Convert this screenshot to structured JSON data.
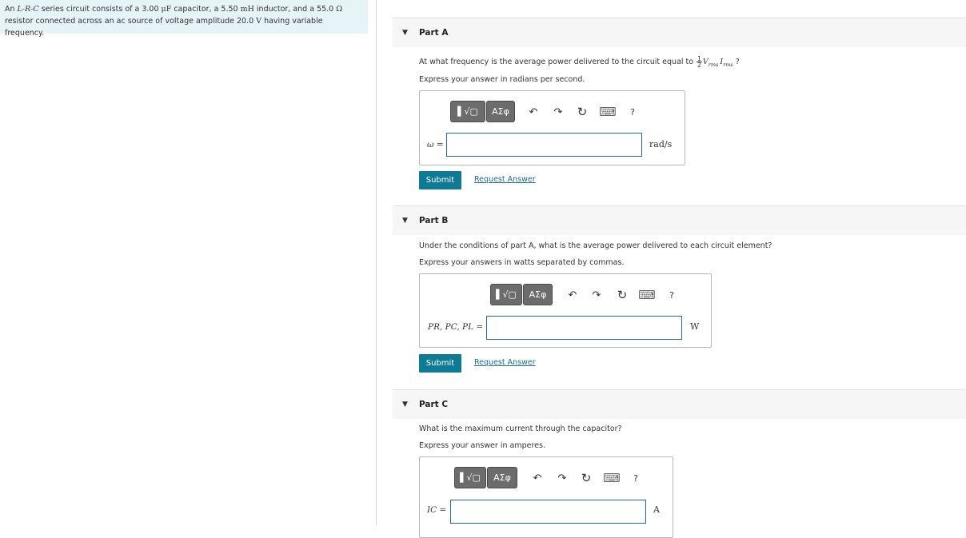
{
  "problem": {
    "text_1": "An ",
    "circuit_type": "L-R-C",
    "text_2": " series circuit consists of a 3.00 ",
    "cap_unit": "μF",
    "text_3": " capacitor, a 5.50 ",
    "ind_unit": "mH",
    "text_4": " inductor, and a 55.0 ",
    "res_unit": "Ω",
    "text_5": "resistor connected across an ac source of voltage amplitude 20.0 ",
    "volt_unit": "V",
    "text_6": " having variable frequency."
  },
  "toolbar": {
    "templates_glyph": "▌√▢",
    "greek_glyph": "ΑΣφ",
    "undo_glyph": "↶",
    "redo_glyph": "↷",
    "reset_glyph": "↻",
    "keyboard_glyph": "⌨",
    "help_glyph": "?"
  },
  "part_a": {
    "arrow": "▼",
    "title": "Part A",
    "question_prefix": "At what frequency is the average power delivered to the circuit equal to ",
    "frac_num": "1",
    "frac_den": "2",
    "v_sym": "V",
    "v_sub": "rms",
    "i_sym": "I",
    "i_sub": "rms",
    "question_suffix": " ?",
    "instruction": "Express your answer in radians per second.",
    "var_label": "ω =",
    "input_value": "",
    "unit": "rad/s",
    "submit": "Submit",
    "request": "Request Answer"
  },
  "part_b": {
    "arrow": "▼",
    "title": "Part B",
    "question": "Under the conditions of part A, what is the average power delivered to each circuit element?",
    "instruction": "Express your answers in watts separated by commas.",
    "var_label": "P_R, P_C, P_L =",
    "var_label_display": "PR, PC, PL =",
    "input_value": "",
    "unit": "W",
    "submit": "Submit",
    "request": "Request Answer"
  },
  "part_c": {
    "arrow": "▼",
    "title": "Part C",
    "question": "What is the maximum current through the capacitor?",
    "instruction": "Express your answer in amperes.",
    "var_label": "IC =",
    "input_value": "",
    "unit": "A"
  }
}
